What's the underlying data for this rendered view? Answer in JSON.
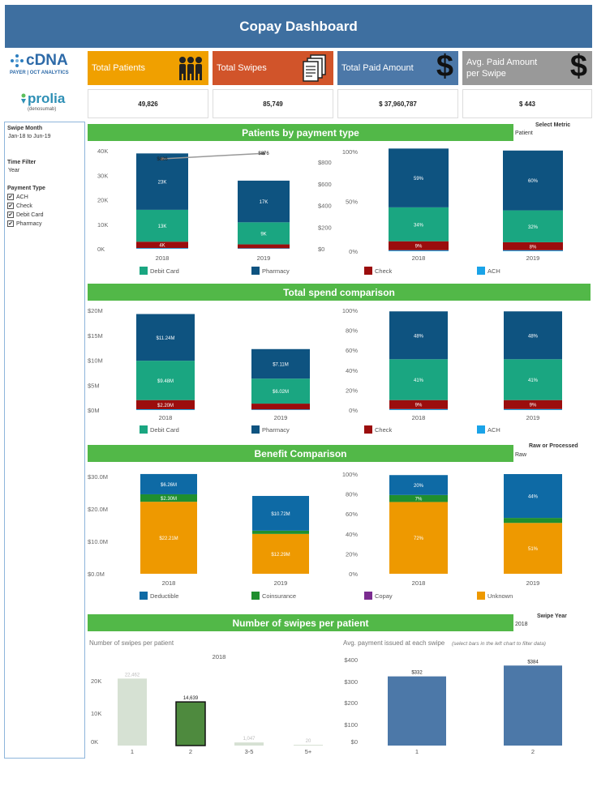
{
  "header": {
    "title": "Copay Dashboard"
  },
  "logos": {
    "cdna_main": "cDNA",
    "cdna_sub": "PAYER | OCT ANALYTICS",
    "prolia_main": "prolia",
    "prolia_sub": "(denosumab)"
  },
  "kpis": [
    {
      "label": "Total Patients",
      "value": "49,826",
      "color": "#f0a000",
      "icon": "people-icon"
    },
    {
      "label": "Total Swipes",
      "value": "85,749",
      "color": "#d1542a",
      "icon": "documents-icon"
    },
    {
      "label": "Total Paid Amount",
      "value": "$ 37,960,787",
      "color": "#4c78a8",
      "icon": "dollar-icon"
    },
    {
      "label": "Avg. Paid Amount per Swipe",
      "value": "$ 443",
      "color": "#999999",
      "icon": "dollar-icon"
    }
  ],
  "sidebar": {
    "swipe_month_title": "Swipe Month",
    "swipe_month_value": "Jan-18 to Jun-19",
    "time_filter_title": "Time Filter",
    "time_filter_value": "Year",
    "payment_type_title": "Payment Type",
    "payment_types": [
      "ACH",
      "Check",
      "Debit Card",
      "Pharmacy"
    ]
  },
  "controls": {
    "select_metric_title": "Select Metric",
    "select_metric_value": "Patient",
    "raw_processed_title": "Raw or Processed",
    "raw_processed_value": "Raw",
    "swipe_year_title": "Swipe Year",
    "swipe_year_value": "2018"
  },
  "colors": {
    "debit": "#1aa681",
    "pharmacy": "#0e5380",
    "check": "#9b0d0d",
    "ach": "#1aa3e8",
    "deductible": "#0e6aa5",
    "coinsurance": "#1f8f2e",
    "copay": "#7b2c90",
    "unknown": "#ee9900",
    "green": "#52b848"
  },
  "legend_payment": [
    "Debit Card",
    "Pharmacy",
    "Check",
    "ACH"
  ],
  "legend_benefit": [
    "Deductible",
    "Coinsurance",
    "Copay",
    "Unknown"
  ],
  "sections": {
    "patients": "Patients by payment type",
    "spend": "Total spend comparison",
    "benefit": "Benefit Comparison",
    "swipes": "Number of swipes per patient"
  },
  "chart_data": [
    {
      "id": "patients-abs",
      "type": "bar",
      "categories": [
        "2018",
        "2019"
      ],
      "series": [
        {
          "name": "ACH",
          "values": [
            0.3,
            0.2
          ],
          "labels": [
            "",
            ""
          ]
        },
        {
          "name": "Check",
          "values": [
            2.6,
            1.6
          ],
          "labels": [
            "4K",
            ""
          ]
        },
        {
          "name": "Debit Card",
          "values": [
            13,
            9
          ],
          "labels": [
            "13K",
            "9K"
          ]
        },
        {
          "name": "Pharmacy",
          "values": [
            23,
            17
          ],
          "labels": [
            "23K",
            "17K"
          ]
        }
      ],
      "line": {
        "values": [
          826,
          876
        ],
        "labels": [
          "$826",
          "$876"
        ],
        "ylim": [
          0,
          900
        ],
        "yticks": [
          "$800",
          "$600",
          "$400",
          "$200",
          "$0"
        ]
      },
      "yticks": [
        "40K",
        "30K",
        "20K",
        "10K",
        "0K"
      ],
      "ylim": [
        0,
        40
      ]
    },
    {
      "id": "patients-pct",
      "type": "bar",
      "categories": [
        "2018",
        "2019"
      ],
      "series": [
        {
          "name": "ACH",
          "values": [
            1,
            1
          ],
          "labels": [
            "",
            ""
          ]
        },
        {
          "name": "Check",
          "values": [
            9,
            8
          ],
          "labels": [
            "9%",
            "8%"
          ]
        },
        {
          "name": "Debit Card",
          "values": [
            34,
            32
          ],
          "labels": [
            "34%",
            "32%"
          ]
        },
        {
          "name": "Pharmacy",
          "values": [
            59,
            60
          ],
          "labels": [
            "59%",
            "60%"
          ]
        }
      ],
      "yticks": [
        "100%",
        "50%",
        "0%"
      ],
      "ylim": [
        0,
        100
      ]
    },
    {
      "id": "spend-abs",
      "type": "bar",
      "categories": [
        "2018",
        "2019"
      ],
      "series": [
        {
          "name": "ACH",
          "values": [
            0.2,
            0.15
          ],
          "labels": [
            "",
            ""
          ]
        },
        {
          "name": "Check",
          "values": [
            2.2,
            1.4
          ],
          "labels": [
            "$2.20M",
            ""
          ]
        },
        {
          "name": "Debit Card",
          "values": [
            9.48,
            6.02
          ],
          "labels": [
            "$9.48M",
            "$6.02M"
          ]
        },
        {
          "name": "Pharmacy",
          "values": [
            11.24,
            7.11
          ],
          "labels": [
            "$11.24M",
            "$7.11M"
          ]
        }
      ],
      "yticks": [
        "$20M",
        "$15M",
        "$10M",
        "$5M",
        "$0M"
      ],
      "ylim": [
        0,
        24
      ]
    },
    {
      "id": "spend-pct",
      "type": "bar",
      "categories": [
        "2018",
        "2019"
      ],
      "series": [
        {
          "name": "ACH",
          "values": [
            1,
            1
          ],
          "labels": [
            "",
            ""
          ]
        },
        {
          "name": "Check",
          "values": [
            9,
            9
          ],
          "labels": [
            "9%",
            "9%"
          ]
        },
        {
          "name": "Debit Card",
          "values": [
            41,
            41
          ],
          "labels": [
            "41%",
            "41%"
          ]
        },
        {
          "name": "Pharmacy",
          "values": [
            48,
            48
          ],
          "labels": [
            "48%",
            "48%"
          ]
        }
      ],
      "yticks": [
        "100%",
        "80%",
        "60%",
        "40%",
        "20%",
        "0%"
      ],
      "ylim": [
        0,
        100
      ]
    },
    {
      "id": "benefit-abs",
      "type": "bar",
      "categories": [
        "2018",
        "2019"
      ],
      "series": [
        {
          "name": "Unknown",
          "values": [
            22.21,
            12.29
          ],
          "labels": [
            "$22.21M",
            "$12.29M"
          ]
        },
        {
          "name": "Coinsurance",
          "values": [
            2.3,
            1.0
          ],
          "labels": [
            "$2.30M",
            ""
          ]
        },
        {
          "name": "Deductible",
          "values": [
            6.26,
            10.72
          ],
          "labels": [
            "$6.26M",
            "$10.72M"
          ]
        }
      ],
      "yticks": [
        "$30.0M",
        "$20.0M",
        "$10.0M",
        "$0.0M"
      ],
      "ylim": [
        0,
        30
      ]
    },
    {
      "id": "benefit-pct",
      "type": "bar",
      "categories": [
        "2018",
        "2019"
      ],
      "series": [
        {
          "name": "Unknown",
          "values": [
            72,
            51
          ],
          "labels": [
            "72%",
            "51%"
          ]
        },
        {
          "name": "Coinsurance",
          "values": [
            7,
            5
          ],
          "labels": [
            "7%",
            ""
          ]
        },
        {
          "name": "Deductible",
          "values": [
            20,
            44
          ],
          "labels": [
            "20%",
            "44%"
          ]
        }
      ],
      "yticks": [
        "100%",
        "80%",
        "60%",
        "40%",
        "20%",
        "0%"
      ],
      "ylim": [
        0,
        100
      ]
    },
    {
      "id": "swipes-count",
      "type": "bar",
      "title": "Number of swipes per patient",
      "subtitle": "2018",
      "categories": [
        "1",
        "2",
        "3-5",
        "5+"
      ],
      "values": [
        22462,
        14639,
        1047,
        20
      ],
      "labels": [
        "22,462",
        "14,639",
        "1,047",
        "20"
      ],
      "yticks": [
        "20K",
        "10K",
        "0K"
      ],
      "ylim": [
        0,
        25000
      ]
    },
    {
      "id": "swipes-avg",
      "type": "bar",
      "title": "Avg. payment issued at each swipe",
      "note": "(select bars in the left chart to filter data)",
      "categories": [
        "1",
        "2"
      ],
      "values": [
        332,
        384
      ],
      "labels": [
        "$332",
        "$384"
      ],
      "yticks": [
        "$400",
        "$300",
        "$200",
        "$100",
        "$0"
      ],
      "ylim": [
        0,
        420
      ]
    }
  ]
}
